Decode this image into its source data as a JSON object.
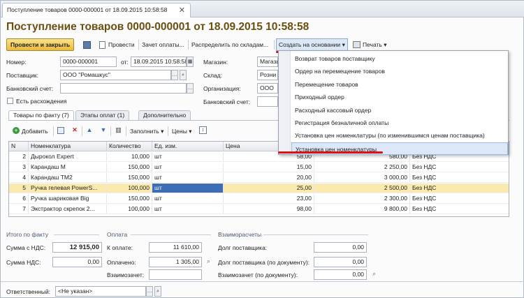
{
  "window": {
    "tab_title": "Поступление товаров 0000-000001 от 18.09.2015 10:58:58",
    "close": "✕",
    "doc_title": "Поступление товаров 0000-000001 от 18.09.2015 10:58:58"
  },
  "toolbar": {
    "post_close": "Провести и закрыть",
    "post": "Провести",
    "offset": "Зачет оплаты...",
    "distribute": "Распределить по складам...",
    "create_based": "Создать на основании",
    "print": "Печать"
  },
  "menu": {
    "items": [
      "Возврат товаров поставщику",
      "Ордер на перемещение товаров",
      "Перемещение товаров",
      "Приходный ордер",
      "Расходный кассовый ордер",
      "Регистрация безналичной оплаты",
      "Установка цен номенклатуры (по изменившимся ценам поставщика)",
      "Установка цен номенклатуры"
    ]
  },
  "form": {
    "number_label": "Номер:",
    "number_value": "0000-000001",
    "date_label": "от:",
    "date_value": "18.09.2015 10:58:58",
    "supplier_label": "Поставщик:",
    "supplier_value": "ООО \"Ромашкус\"",
    "account_label": "Банковский счет:",
    "account_value": "",
    "discrepancy_label": "Есть расхождения",
    "store_label": "Магазин:",
    "store_value": "Магази",
    "warehouse_label": "Склад:",
    "warehouse_value": "Розни",
    "org_label": "Организация:",
    "org_value": "ООО",
    "bank_account_label": "Банковский счет:"
  },
  "tabs": [
    "Товары по факту (7)",
    "Этапы оплат (1)",
    "Дополнительно"
  ],
  "table_toolbar": {
    "add": "Добавить",
    "fill": "Заполнить",
    "prices": "Цены"
  },
  "table": {
    "headers": [
      "N",
      "Номенклатура",
      "Количество",
      "Ед. изм.",
      "Цена",
      "",
      ""
    ],
    "rows": [
      [
        "2",
        "Дырокол Expert",
        "10,000",
        "шт",
        "58,00",
        "580,00",
        "Без НДС"
      ],
      [
        "3",
        "Карандаш M",
        "150,000",
        "шт",
        "15,00",
        "2 250,00",
        "Без НДС"
      ],
      [
        "4",
        "Карандаш TM2",
        "150,000",
        "шт",
        "20,00",
        "3 000,00",
        "Без НДС"
      ],
      [
        "5",
        "Ручка гелевая PowerS...",
        "100,000",
        "шт",
        "25,00",
        "2 500,00",
        "Без НДС"
      ],
      [
        "6",
        "Ручка шариковая Big",
        "150,000",
        "шт",
        "23,00",
        "2 300,00",
        "Без НДС"
      ],
      [
        "7",
        "Экстрактор скрепок 2...",
        "100,000",
        "шт",
        "98,00",
        "9 800,00",
        "Без НДС"
      ]
    ],
    "selected_row": 3
  },
  "totals": {
    "section_title": "Итого по факту",
    "sum_vat_label": "Сумма с НДС:",
    "sum_vat_value": "12 915,00",
    "vat_label": "Сумма НДС:",
    "vat_value": "0,00"
  },
  "payment": {
    "section_title": "Оплата",
    "to_pay_label": "К оплате:",
    "to_pay_value": "11 610,00",
    "paid_label": "Оплачено:",
    "paid_value": "1 305,00",
    "offset_label": "Взаимозачет:",
    "offset_value": ""
  },
  "settlements": {
    "section_title": "Взаиморасчеты",
    "supplier_debt_label": "Долг поставщика:",
    "supplier_debt_value": "0,00",
    "supplier_debt_doc_label": "Долг поставщика (по документу):",
    "supplier_debt_doc_value": "0,00",
    "offset_doc_label": "Взаимозачет (по документу):",
    "offset_doc_value": "0,00"
  },
  "footer": {
    "responsible_label": "Ответственный:",
    "responsible_value": "<Не указан>"
  },
  "colors": {
    "title": "#6b4f10",
    "selection": "#3d6db5",
    "row_highlight": "#fbeab0",
    "annotation": "#d11111"
  }
}
